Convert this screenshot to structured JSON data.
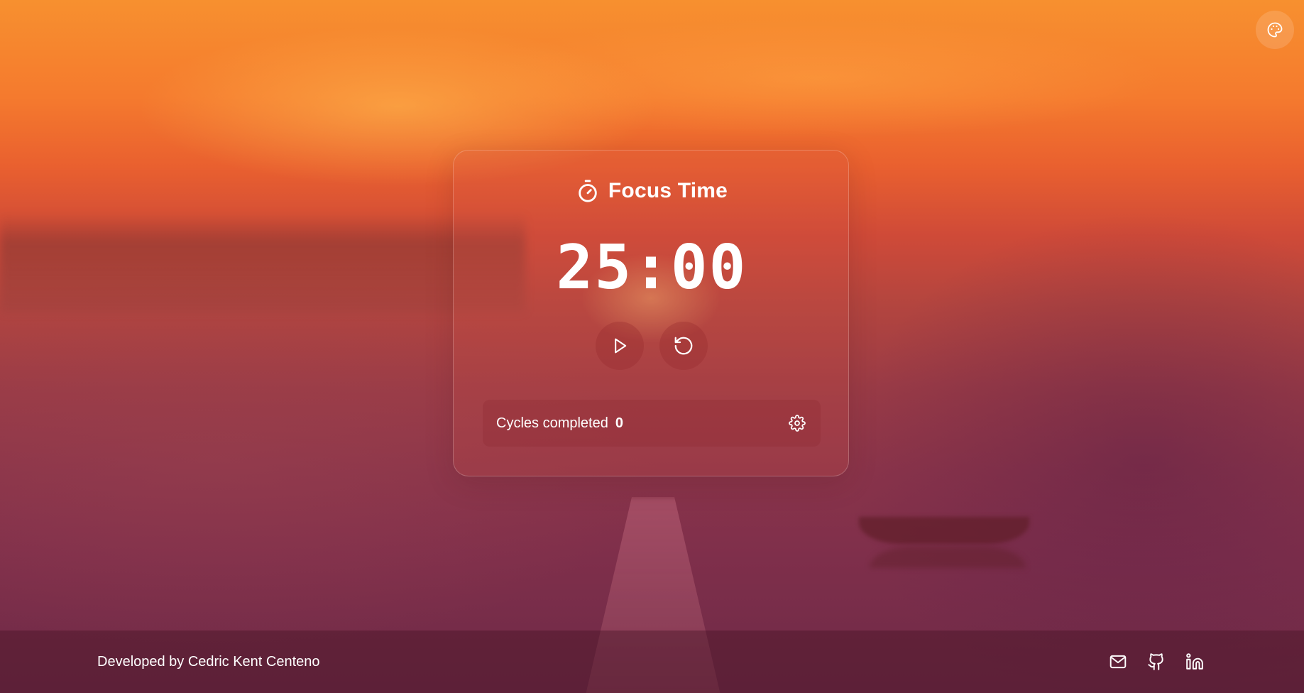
{
  "theme": {
    "accent": "#ffffff",
    "background_top": "#f7902f",
    "background_bottom": "#6e2a47"
  },
  "header": {
    "theme_button_icon": "palette-icon"
  },
  "timer_card": {
    "mode_icon": "stopwatch-icon",
    "mode_label": "Focus Time",
    "time_display": "25:00",
    "play_button_icon": "play-icon",
    "reset_button_icon": "reset-icon",
    "cycles_label": "Cycles completed",
    "cycles_count": "0",
    "settings_icon": "gear-icon"
  },
  "footer": {
    "credit": "Developed by Cedric Kent Centeno",
    "links": [
      {
        "icon": "mail-icon"
      },
      {
        "icon": "github-icon"
      },
      {
        "icon": "linkedin-icon"
      }
    ]
  }
}
